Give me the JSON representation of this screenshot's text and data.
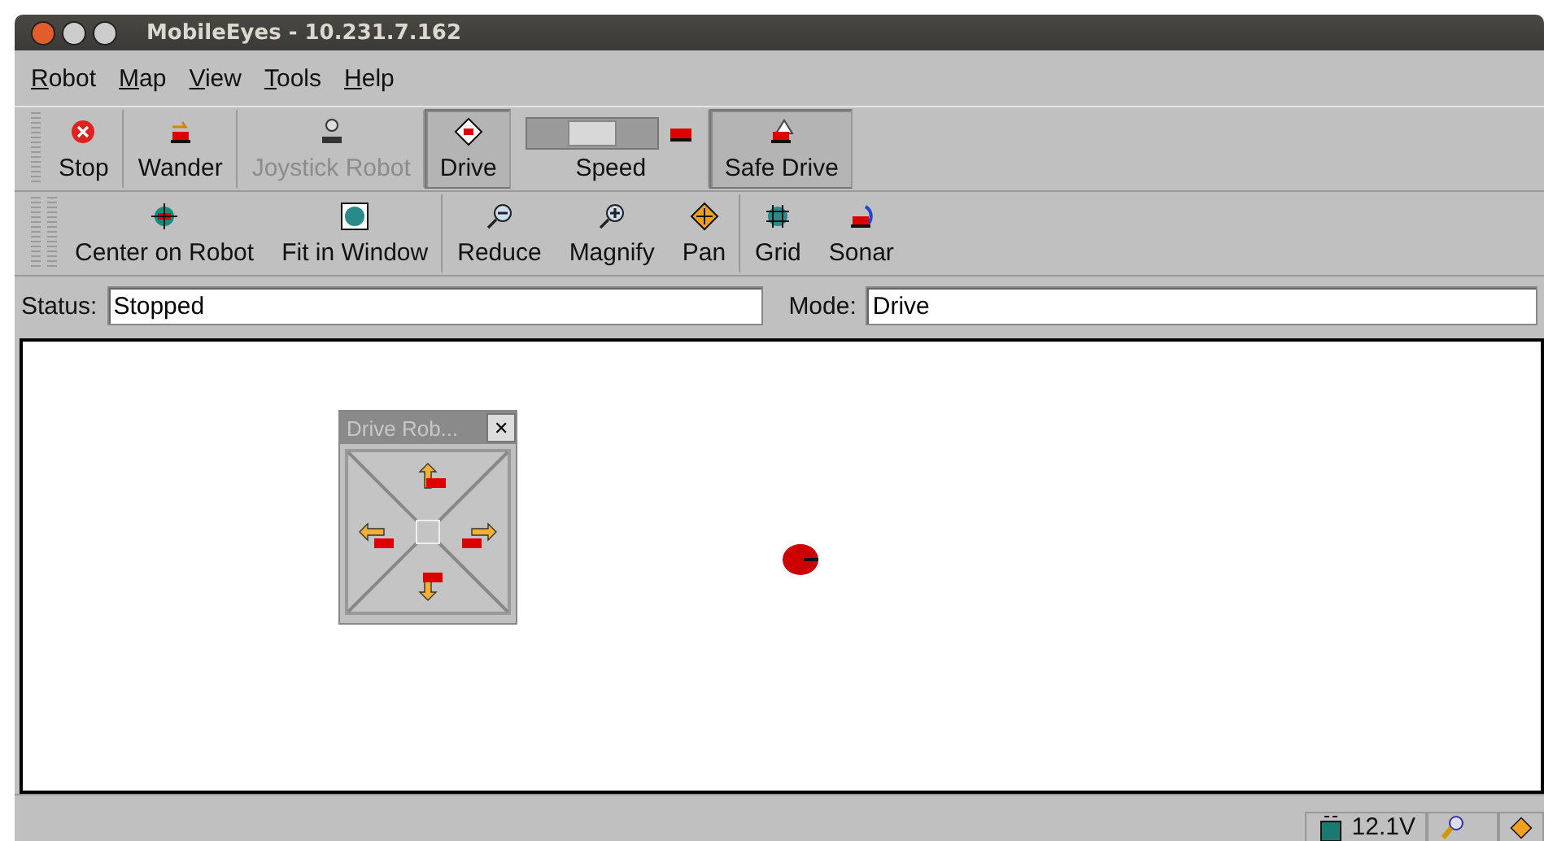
{
  "window": {
    "title": "MobileEyes - 10.231.7.162"
  },
  "menu": [
    {
      "label": "Robot"
    },
    {
      "label": "Map"
    },
    {
      "label": "View"
    },
    {
      "label": "Tools"
    },
    {
      "label": "Help"
    }
  ],
  "toolbar_1": [
    {
      "kind": "button",
      "label": "Stop",
      "selected": false,
      "disabled": false
    },
    {
      "kind": "button",
      "label": "Wander",
      "selected": false,
      "disabled": false
    },
    {
      "kind": "button",
      "label": "Joystick Robot",
      "selected": false,
      "disabled": true
    },
    {
      "kind": "button",
      "label": "Drive",
      "selected": true,
      "disabled": false
    },
    {
      "kind": "speed",
      "label": "Speed",
      "level": 0.5
    },
    {
      "kind": "button",
      "label": "Safe Drive",
      "selected": true,
      "disabled": false
    }
  ],
  "toolbar_2": [
    {
      "label": "Center on Robot"
    },
    {
      "label": "Fit in Window"
    },
    {
      "label": "Reduce"
    },
    {
      "label": "Magnify"
    },
    {
      "label": "Pan"
    },
    {
      "label": "Grid"
    },
    {
      "label": "Sonar"
    }
  ],
  "status": {
    "label": "Status:",
    "value": "Stopped"
  },
  "mode": {
    "label": "Mode:",
    "value": "Drive"
  },
  "drive_panel": {
    "title": "Drive Rob...",
    "close": "✕"
  },
  "status_bar": {
    "voltage": "12.1V"
  }
}
